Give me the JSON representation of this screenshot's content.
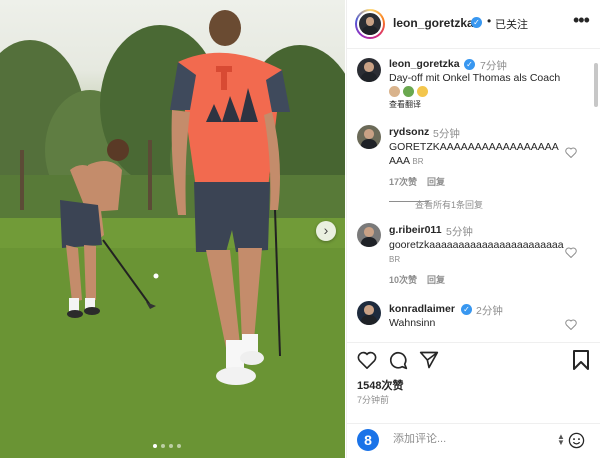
{
  "post": {
    "username": "leon_goretzka",
    "follow_status": "已关注",
    "more_icon": "more-horizontal-icon",
    "media_dots": 4,
    "media_active_index": 0
  },
  "caption": {
    "username": "leon_goretzka",
    "time": "7分钟",
    "text": "Day-off mit Onkel Thomas als Coach",
    "emojis": [
      "older-man-emoji",
      "golfer-emoji",
      "thumbs-up-emoji"
    ],
    "translate": "查看翻译"
  },
  "comments": [
    {
      "username": "rydsonz",
      "time": "5分钟",
      "text": "GORETZKAAAAAAAAAAAAAAAAAAAA",
      "flag": "BR",
      "likes": "17次赞",
      "reply": "回复"
    },
    {
      "username": "g.ribeir011",
      "time": "5分钟",
      "text": "gooretzkaaaaaaaaaaaaaaaaaaaaaaa",
      "flag": "BR",
      "likes": "10次赞",
      "reply": "回复"
    },
    {
      "username": "konradlaimer",
      "time": "2分钟",
      "text": "Wahnsinn"
    }
  ],
  "view_replies": "查看所有1条回复",
  "actions": {
    "likes": "1548次赞",
    "posted_ago": "7分钟前"
  },
  "add_comment": {
    "placeholder": "添加评论..."
  },
  "colors": {
    "verified": "#3897f0",
    "text": "#262626",
    "muted": "#8e8e8e",
    "shirt": "#f26a4f",
    "grass": "#6c9535"
  }
}
